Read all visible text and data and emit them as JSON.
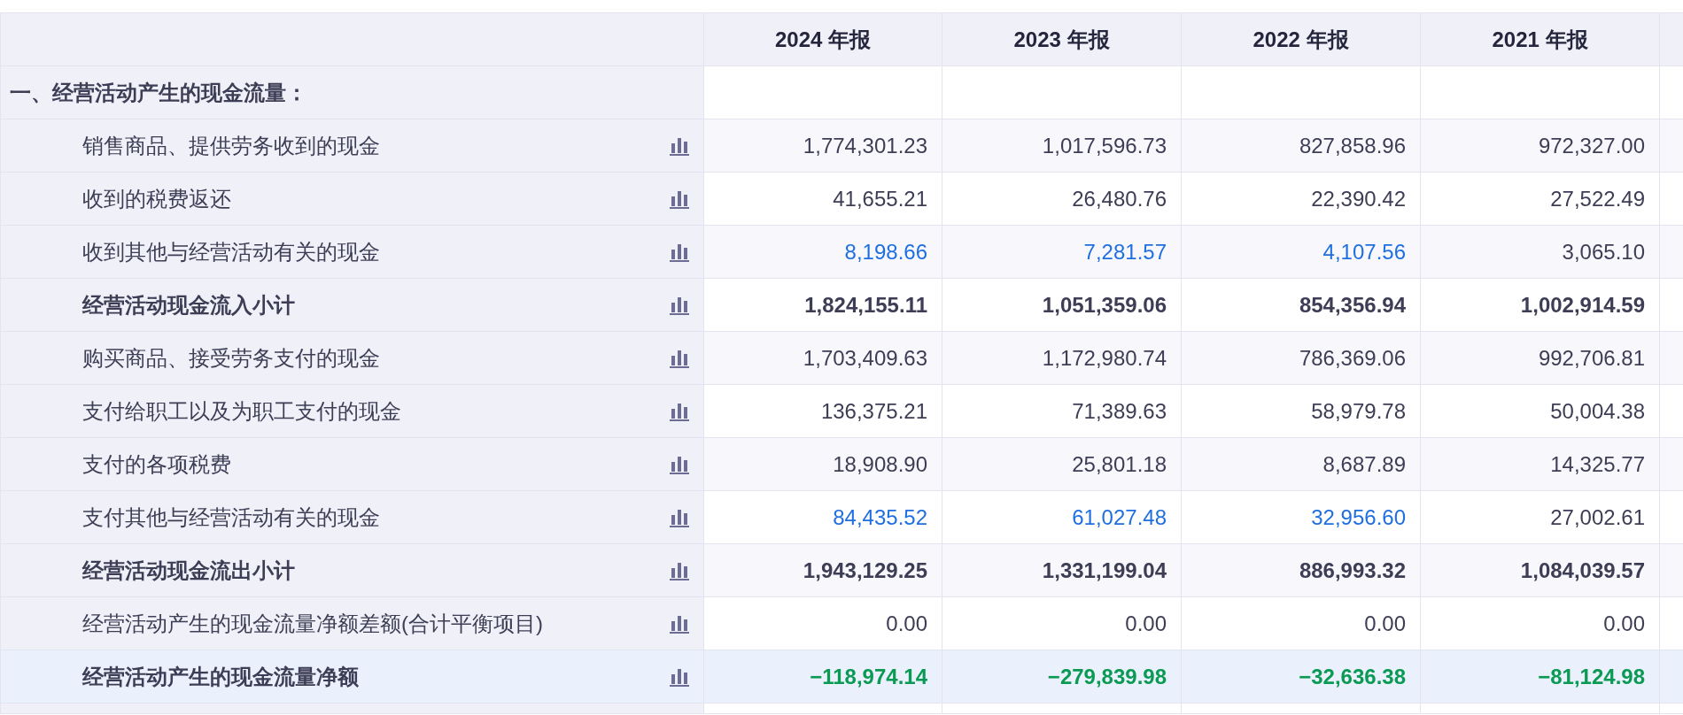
{
  "table": {
    "columns": [
      "2024 年报",
      "2023 年报",
      "2022 年报",
      "2021 年报"
    ],
    "section": {
      "label": "一、经营活动产生的现金流量："
    },
    "rows": [
      {
        "kind": "item",
        "label": "销售商品、提供劳务收到的现金",
        "values": [
          {
            "text": "1,774,301.23",
            "link": false
          },
          {
            "text": "1,017,596.73",
            "link": false
          },
          {
            "text": "827,858.96",
            "link": false
          },
          {
            "text": "972,327.00",
            "link": false
          }
        ]
      },
      {
        "kind": "item",
        "label": "收到的税费返还",
        "values": [
          {
            "text": "41,655.21",
            "link": false
          },
          {
            "text": "26,480.76",
            "link": false
          },
          {
            "text": "22,390.42",
            "link": false
          },
          {
            "text": "27,522.49",
            "link": false
          }
        ]
      },
      {
        "kind": "item",
        "label": "收到其他与经营活动有关的现金",
        "values": [
          {
            "text": "8,198.66",
            "link": true
          },
          {
            "text": "7,281.57",
            "link": true
          },
          {
            "text": "4,107.56",
            "link": true
          },
          {
            "text": "3,065.10",
            "link": false
          }
        ]
      },
      {
        "kind": "subtotal",
        "label": "经营活动现金流入小计",
        "values": [
          {
            "text": "1,824,155.11",
            "link": false
          },
          {
            "text": "1,051,359.06",
            "link": false
          },
          {
            "text": "854,356.94",
            "link": false
          },
          {
            "text": "1,002,914.59",
            "link": false
          }
        ]
      },
      {
        "kind": "item",
        "label": "购买商品、接受劳务支付的现金",
        "values": [
          {
            "text": "1,703,409.63",
            "link": false
          },
          {
            "text": "1,172,980.74",
            "link": false
          },
          {
            "text": "786,369.06",
            "link": false
          },
          {
            "text": "992,706.81",
            "link": false
          }
        ]
      },
      {
        "kind": "item",
        "label": "支付给职工以及为职工支付的现金",
        "values": [
          {
            "text": "136,375.21",
            "link": false
          },
          {
            "text": "71,389.63",
            "link": false
          },
          {
            "text": "58,979.78",
            "link": false
          },
          {
            "text": "50,004.38",
            "link": false
          }
        ]
      },
      {
        "kind": "item",
        "label": "支付的各项税费",
        "values": [
          {
            "text": "18,908.90",
            "link": false
          },
          {
            "text": "25,801.18",
            "link": false
          },
          {
            "text": "8,687.89",
            "link": false
          },
          {
            "text": "14,325.77",
            "link": false
          }
        ]
      },
      {
        "kind": "item",
        "label": "支付其他与经营活动有关的现金",
        "values": [
          {
            "text": "84,435.52",
            "link": true
          },
          {
            "text": "61,027.48",
            "link": true
          },
          {
            "text": "32,956.60",
            "link": true
          },
          {
            "text": "27,002.61",
            "link": false
          }
        ]
      },
      {
        "kind": "subtotal",
        "label": "经营活动现金流出小计",
        "values": [
          {
            "text": "1,943,129.25",
            "link": false
          },
          {
            "text": "1,331,199.04",
            "link": false
          },
          {
            "text": "886,993.32",
            "link": false
          },
          {
            "text": "1,084,039.57",
            "link": false
          }
        ]
      },
      {
        "kind": "item",
        "label": "经营活动产生的现金流量净额差额(合计平衡项目)",
        "values": [
          {
            "text": "0.00",
            "link": false
          },
          {
            "text": "0.00",
            "link": false
          },
          {
            "text": "0.00",
            "link": false
          },
          {
            "text": "0.00",
            "link": false
          }
        ]
      },
      {
        "kind": "net",
        "label": "经营活动产生的现金流量净额",
        "values": [
          {
            "text": "−118,974.14",
            "link": false
          },
          {
            "text": "−279,839.98",
            "link": false
          },
          {
            "text": "−32,636.38",
            "link": false
          },
          {
            "text": "−81,124.98",
            "link": false
          }
        ]
      }
    ]
  }
}
